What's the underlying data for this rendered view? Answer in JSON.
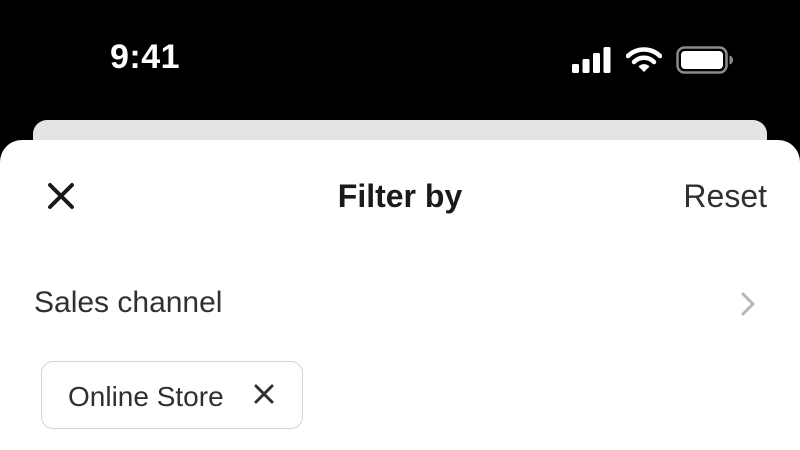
{
  "status_bar": {
    "time": "9:41",
    "icons": [
      "cellular-signal-icon",
      "wifi-icon",
      "battery-icon"
    ]
  },
  "sheet": {
    "title": "Filter by",
    "reset_label": "Reset",
    "close_icon": "close-icon"
  },
  "filters": [
    {
      "label": "Sales channel",
      "chevron_icon": "chevron-right-icon",
      "selected": [
        {
          "label": "Online Store",
          "remove_icon": "close-icon"
        }
      ]
    }
  ],
  "colors": {
    "status_bar_bg": "#000000",
    "sheet_bg": "#ffffff",
    "sheet_behind_bg": "#e3e3e3",
    "text_primary": "#1a1a1a",
    "text_secondary": "#303030",
    "chip_border": "#d4d4d4",
    "chevron": "#b5b5b5"
  }
}
